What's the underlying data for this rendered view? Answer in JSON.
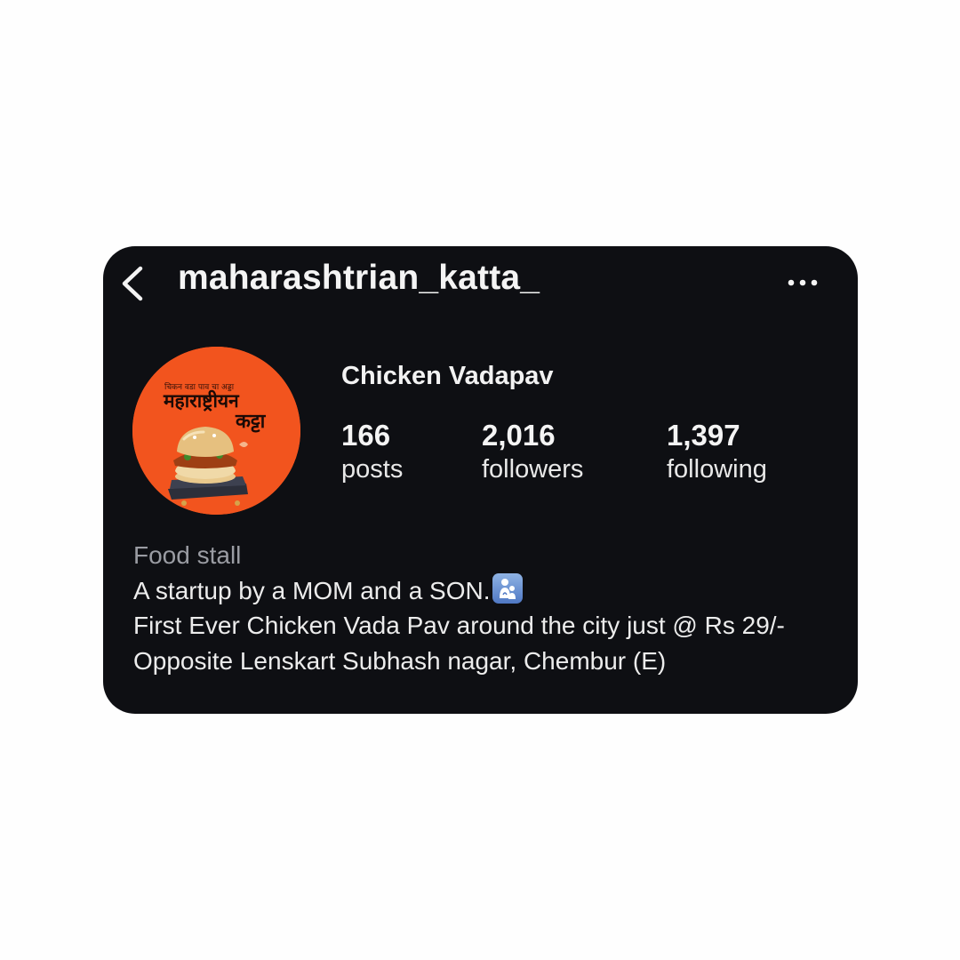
{
  "header": {
    "username": "maharashtrian_katta_"
  },
  "avatar": {
    "top_text": "चिकन वडा पाव चा अड्डा",
    "title_line1": "महाराष्ट्रीयन",
    "title_line2": "कट्टा"
  },
  "profile": {
    "name": "Chicken Vadapav",
    "stats": [
      {
        "value": "166",
        "label": "posts"
      },
      {
        "value": "2,016",
        "label": "followers"
      },
      {
        "value": "1,397",
        "label": "following"
      }
    ]
  },
  "bio": {
    "category": "Food stall",
    "line1": "A startup by a MOM and a SON.",
    "line1_emoji": "family-mother-son-emoji",
    "line2": "First Ever Chicken Vada Pav around the city just @ Rs 29/-",
    "line3": "Opposite Lenskart Subhash nagar, Chembur (E)"
  },
  "colors": {
    "background": "#fefefe",
    "card": "#0e0f13",
    "avatar_orange": "#f2541e",
    "category_gray": "#9a9ca3"
  }
}
